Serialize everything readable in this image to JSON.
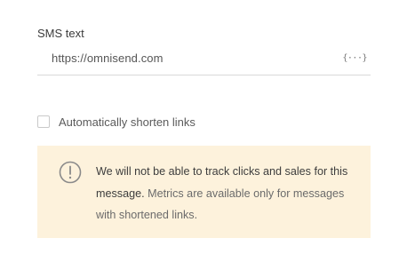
{
  "sms": {
    "label": "SMS text",
    "value": "https://omnisend.com",
    "merge_tag_label": "{···}"
  },
  "shorten_links": {
    "label": "Automatically shorten links",
    "checked": false
  },
  "warning": {
    "icon": "exclamation-circle-icon",
    "bold_text": "We will not be able to track clicks and sales for this message.",
    "normal_text": " Metrics are available only for messages with shortened links.",
    "background_color": "#fdf2dc"
  }
}
